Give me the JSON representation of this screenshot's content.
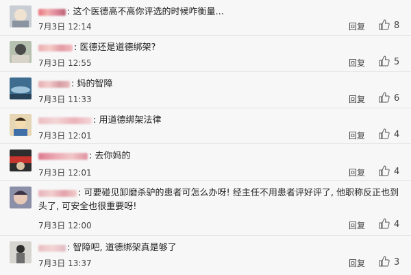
{
  "colors": {
    "background": "#f7f7f7",
    "divider": "#e4e4e4",
    "text": "#222222"
  },
  "comments": [
    {
      "text": "这个医德高不高你评选的时候咋衡量...",
      "date": "7月3日",
      "time": "12:14",
      "reply": "回复",
      "likes": "8"
    },
    {
      "text": "医德还是道德绑架?",
      "date": "7月3日",
      "time": "12:55",
      "reply": "回复",
      "likes": "5"
    },
    {
      "text": "妈的智障",
      "date": "7月3日",
      "time": "11:33",
      "reply": "回复",
      "likes": "6"
    },
    {
      "text": "用道德绑架法律",
      "date": "7月3日",
      "time": "12:01",
      "reply": "回复",
      "likes": "4"
    },
    {
      "text": "去你妈的",
      "date": "7月3日",
      "time": "12:01",
      "reply": "回复",
      "likes": "4"
    },
    {
      "text": "可要碰见卸磨杀驴的患者可怎么办呀! 经主任不用患者评好评了, 他职称反正也到",
      "text2": "头了, 可安全也很重要呀!",
      "date": "7月3日",
      "time": "12:00",
      "reply": "回复",
      "likes": "4"
    },
    {
      "text": "智障吧, 道德绑架真是够了",
      "date": "7月3日",
      "time": "13:37",
      "reply": "回复",
      "likes": "3"
    }
  ]
}
